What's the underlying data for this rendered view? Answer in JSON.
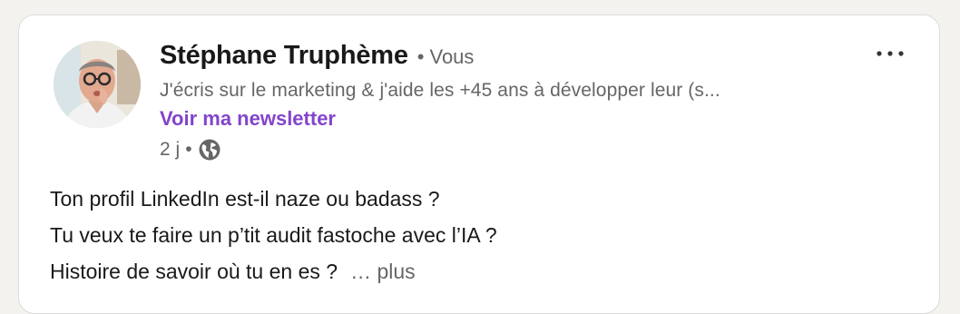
{
  "post": {
    "author": {
      "name": "Stéphane Truphème",
      "separator": "•",
      "relation": "Vous",
      "headline": "J'écris sur le marketing & j'aide les +45 ans à développer leur (s...",
      "newsletter_link": "Voir ma newsletter",
      "avatar_icon": "profile-photo"
    },
    "meta": {
      "time": "2 j",
      "separator": "•",
      "visibility_icon": "globe-icon"
    },
    "menu_icon": "more-options-icon",
    "text_lines": [
      "Ton profil LinkedIn est-il naze ou badass ?",
      "Tu veux te faire un p’tit audit fastoche avec l’IA ?",
      "Histoire de savoir où tu en es ?"
    ],
    "see_more": "… plus"
  },
  "colors": {
    "newsletter": "#8344cc",
    "secondary_text": "#666666",
    "primary_text": "#1a1a1a",
    "card_border": "#dcdcdc"
  }
}
